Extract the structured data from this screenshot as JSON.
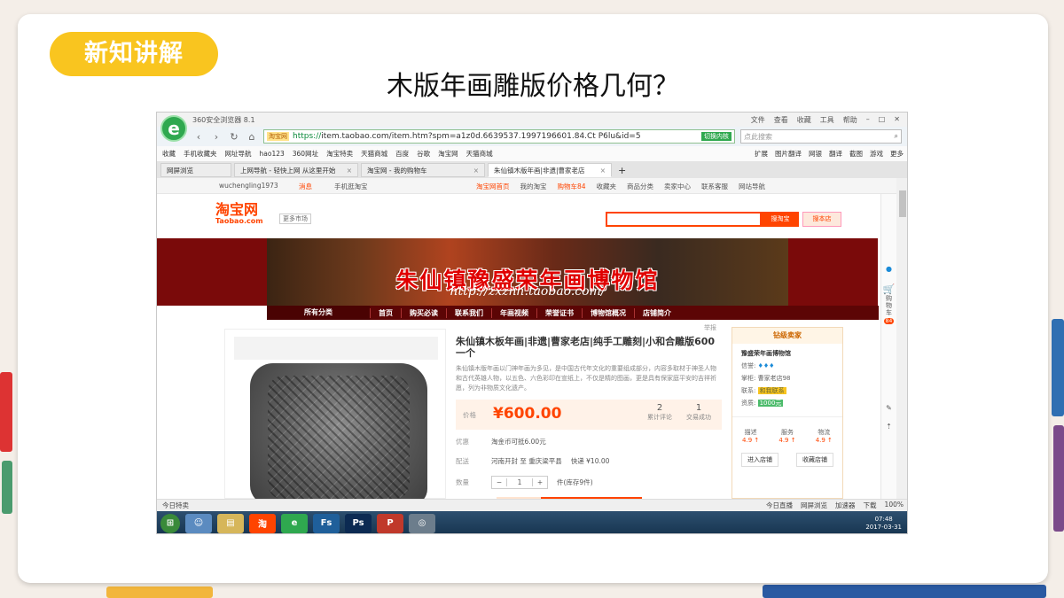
{
  "slide": {
    "badge": "新知讲解",
    "title": "木版年画雕版价格几何？"
  },
  "browser": {
    "app_title": "360安全浏览器 8.1",
    "menus": [
      "文件",
      "查看",
      "收藏",
      "工具",
      "帮助"
    ],
    "nav_icons": [
      "‹",
      "›",
      "↻",
      "⌂",
      "☆"
    ],
    "address": {
      "site_tag": "淘宝网",
      "url_prefix": "https://",
      "url_rest": "item.taobao.com/item.htm?spm=a1z0d.6639537.1997196601.84.Ct P6lu&id=5",
      "pill": "切换内核"
    },
    "search": {
      "placeholder": "点此搜索",
      "icon": "search-icon"
    },
    "bookmarks": [
      "收藏",
      "手机收藏夹",
      "网址导航",
      "hao123",
      "360网址",
      "淘宝特卖",
      "天猫商城",
      "百度",
      "谷歌",
      "淘宝网",
      "天猫商城"
    ],
    "toolbar_right": [
      "扩展",
      "图片翻译",
      "网银",
      "翻译",
      "截图",
      "游戏",
      "更多"
    ],
    "tabs": [
      {
        "label": "网屏浏览",
        "active": false
      },
      {
        "label": "上网导航 - 轻快上网 从这里开始",
        "active": false
      },
      {
        "label": "淘宝网 - 我的购物车",
        "active": false
      },
      {
        "label": "朱仙镇木版年画|非遗|曹家老店",
        "active": true
      }
    ]
  },
  "taobao": {
    "top": {
      "user": "wuchengling1973",
      "message": "消息",
      "mobile": "手机逛淘宝",
      "links": [
        "淘宝网首页",
        "我的淘宝",
        "购物车84",
        "收藏夹",
        "商品分类",
        "卖家中心",
        "联系客服",
        "网站导航"
      ]
    },
    "logo": "淘宝网",
    "logo_sub": "Taobao.com",
    "more_market": "更多市场",
    "search_button": "搜淘宝",
    "store_button": "搜本店",
    "banner": {
      "title": "朱仙镇豫盛荣年画博物馆",
      "url": "http://zxznh.taobao.com/"
    },
    "shop_nav": [
      "所有分类",
      "首页",
      "购买必读",
      "联系我们",
      "年画视频",
      "荣誉证书",
      "博物馆概况",
      "店铺简介"
    ],
    "report": "举报",
    "product": {
      "title": "朱仙镇木板年画|非遗|曹家老店|纯手工雕刻|小和合雕版600一个",
      "desc": "朱仙镇木版年画以门神年画为多见，是中国古代年文化的重要组成部分，内容多取材于神圣人物和古代英雄人物，以五色、六色彩印在宣纸上，不仅是精的图画，更是具有保家庭平安的吉祥祈愿，列为非物质文化遗产。",
      "price_label": "价格",
      "price": "¥600.00",
      "reviews_count": "2",
      "reviews_label": "累计评论",
      "deals_count": "1",
      "deals_label": "交易成功",
      "promo_label": "优惠",
      "promo": "淘金币可抵6.00元",
      "ship_label": "配送",
      "ship_from": "河南开封 至 重庆梁平县",
      "ship_fee": "快递 ¥10.00",
      "qty_label": "数量",
      "qty": "1",
      "stock": "件(库存9件)"
    },
    "seller": {
      "header": "钻级卖家",
      "name": "豫盛荣年画博物馆",
      "credit_label": "信誉:",
      "credit": "♦♦♦",
      "keeper_label": "掌柜:",
      "keeper": "曹家老店98",
      "contact_label": "联系:",
      "contact": "和我联系",
      "qual_label": "资质:",
      "qual": "1000元",
      "score_labels": [
        "描述",
        "服务",
        "物流"
      ],
      "scores": [
        "4.9 ↑",
        "4.9 ↑",
        "4.9 ↑"
      ],
      "enter_store": "进入店铺",
      "fav_store": "收藏店铺"
    },
    "sidebar": {
      "cart_label": "购物车",
      "cart_count": "84"
    }
  },
  "statusbar": {
    "left": "今日特卖",
    "items": [
      "今日直播",
      "网屏浏览",
      "加速器",
      "下载",
      "100%"
    ]
  },
  "taskbar": {
    "apps": [
      "⊞",
      "☺",
      "▤",
      "淘",
      "e",
      "Fs",
      "Ps",
      "P",
      "◎"
    ],
    "time": "07:48",
    "date": "2017-03-31"
  },
  "colors": {
    "badge": "#f9c51f",
    "taobao_orange": "#ff4400",
    "banner_red": "#7a0a0a",
    "browser_green": "#2fa84f"
  }
}
